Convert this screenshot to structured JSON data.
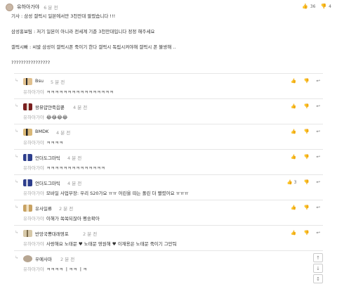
{
  "post": {
    "author": "유하아가야",
    "time": "6 분 전",
    "likes": "36",
    "dislikes": "4",
    "lines": [
      "기사 : 삼성 갤럭시 일본에서만 3천만대 팔렸습니다 !!!",
      "",
      "삼성홍보팀 : 저기 일본이 아니라 전세계 기준 3천만대입니다 정정 해주세요",
      "",
      "갤럭시빠 : 씨발 삼성이 갤럭시폰 죽이기 한다 갤럭시 독립시켜야해 갤럭시 폰 불쌍해 ..",
      "",
      "????????????????"
    ]
  },
  "quote_prefix": "유하아가야",
  "comments": [
    {
      "author": "Bsu",
      "time": "5 분 전",
      "text": "ㅋㅋㅋㅋㅋㅋㅋㅋㅋㅋㅋㅋㅋㅋㅋㅋ",
      "up": "",
      "down": "",
      "avatar": "av1"
    },
    {
      "author": "왕뮤얍얀죽읍뿐",
      "time": "4 분 전",
      "text": "😂😂😂😂",
      "up": "",
      "down": "",
      "avatar": "av2"
    },
    {
      "author": "BMDK",
      "time": "4 분 전",
      "text": "ㅋㅋㅋㅋ",
      "up": "",
      "down": "",
      "avatar": "av3"
    },
    {
      "author": "언더도그마틱",
      "time": "4 분 전",
      "text": "ㅋㅋㅋㅋㅋㅋㅋㅋㅋㅋㅋㅋㅋㅋ",
      "up": "",
      "down": "",
      "avatar": "av4"
    },
    {
      "author": "언더도그마틱",
      "time": "4 분 전",
      "text": "모바일 사업부장: 우리 S20가요 ㅠㅠ 어린을 따는 폴린 더 빨렸어요 ㅠㅠㅠ",
      "up": "3",
      "down": "",
      "avatar": "av4"
    },
    {
      "author": "유사일류",
      "time": "2 분 전",
      "text": "이해가 쏙쏙되잖아 펭숭확아",
      "up": "",
      "down": "",
      "avatar": "av5"
    },
    {
      "author": "반앙국뽕대래영포",
      "time": "2 분 전",
      "text": "사랑해요 노태문 ♥ 노태문 영원해 ♥ 이재용은 노태문 죽이기 그만둬",
      "up": "",
      "down": "",
      "avatar": "av6"
    },
    {
      "author": "우예사마",
      "time": "2 분 전",
      "text": "ㅋㅋㅋㅋ ㅣㅋㅋ ㅣㅋ",
      "up": "",
      "down": "",
      "avatar": "av7"
    }
  ],
  "icons": {
    "like": "thumbs-up-icon",
    "dislike": "thumbs-down-icon",
    "reply": "reply-arrow-icon",
    "scroll_up": "arrow-up-icon",
    "scroll_down": "arrow-down-icon"
  }
}
